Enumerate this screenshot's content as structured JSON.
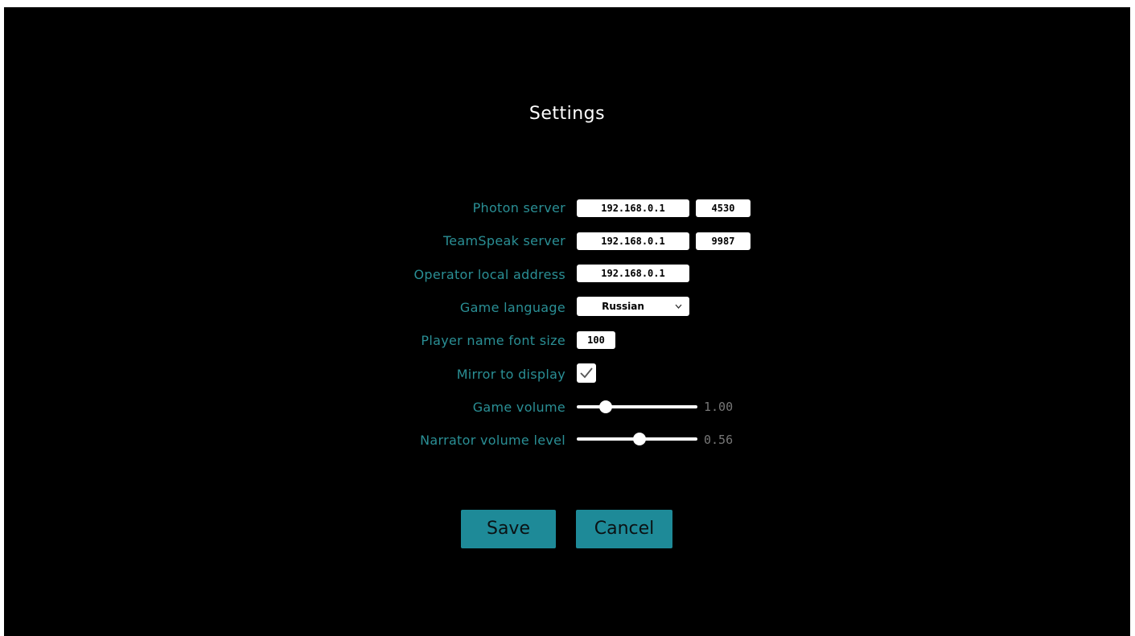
{
  "settings": {
    "title": "Settings",
    "photon": {
      "label": "Photon server",
      "ip": "192.168.0.1",
      "port": "4530"
    },
    "teamspeak": {
      "label": "TeamSpeak server",
      "ip": "192.168.0.1",
      "port": "9987"
    },
    "operator": {
      "label": "Operator local address",
      "ip": "192.168.0.1"
    },
    "language": {
      "label": "Game language",
      "value": "Russian"
    },
    "font_size": {
      "label": "Player name font size",
      "value": "100"
    },
    "mirror": {
      "label": "Mirror to display",
      "checked": true
    },
    "game_volume": {
      "label": "Game volume",
      "value_text": "1.00",
      "level": 0.24
    },
    "narrator_volume": {
      "label": "Narrator volume level",
      "value_text": "0.56",
      "level": 0.52
    },
    "buttons": {
      "save": "Save",
      "cancel": "Cancel"
    }
  },
  "colors": {
    "background": "#000000",
    "label": "#2a8f95",
    "button": "#1e8a98",
    "field": "#ffffff"
  },
  "icons": {
    "checkmark": "check-icon",
    "dropdown": "chevron-down-icon"
  }
}
